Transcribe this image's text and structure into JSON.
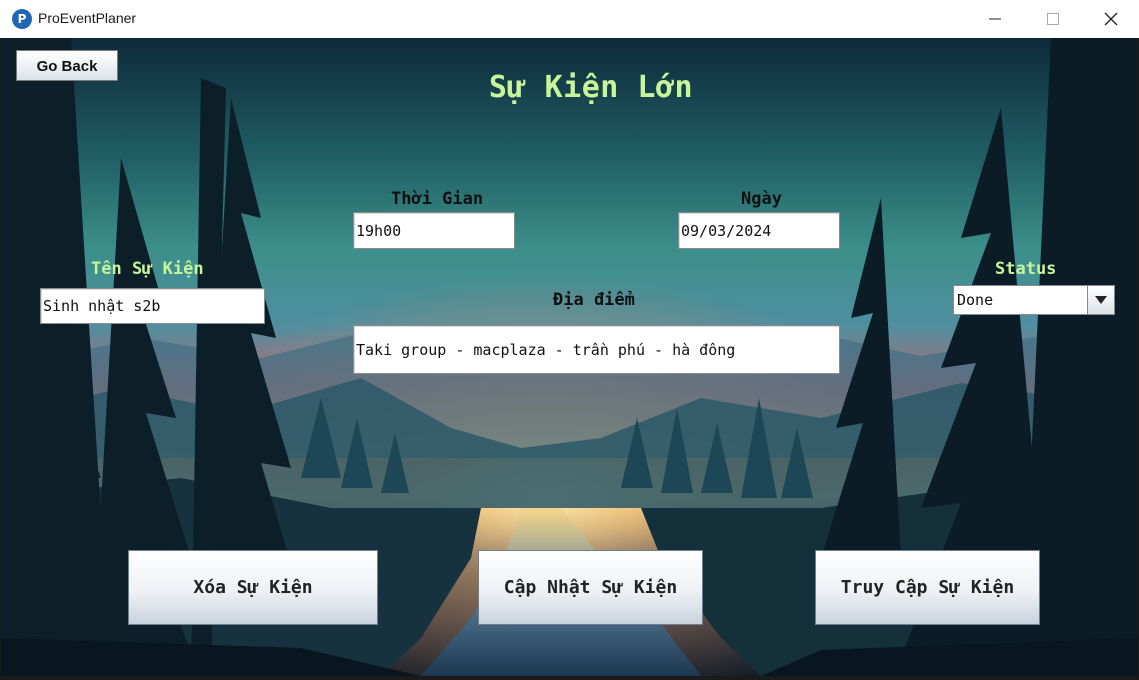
{
  "window": {
    "title": "ProEventPlaner",
    "controls": {
      "minimize": "minimize-icon",
      "maximize": "maximize-icon",
      "close": "close-icon"
    }
  },
  "toolbar": {
    "go_back_label": "Go Back"
  },
  "page": {
    "title": "Sự Kiện Lớn"
  },
  "form": {
    "time_label": "Thời Gian",
    "time_value": "19h00",
    "date_label": "Ngày",
    "date_value": "09/03/2024",
    "name_label": "Tên Sự Kiện",
    "name_value": "Sinh nhật s2b",
    "location_label": "Địa điểm",
    "location_value": "Taki group - macplaza - trần phú - hà đông",
    "status_label": "Status",
    "status_value": "Done"
  },
  "actions": {
    "delete_label": "Xóa Sự Kiện",
    "update_label": "Cập Nhật Sự Kiện",
    "access_label": "Truy Cập Sự Kiện"
  },
  "colors": {
    "accent_label": "#c8f59a",
    "app_icon": "#1f66b6"
  }
}
